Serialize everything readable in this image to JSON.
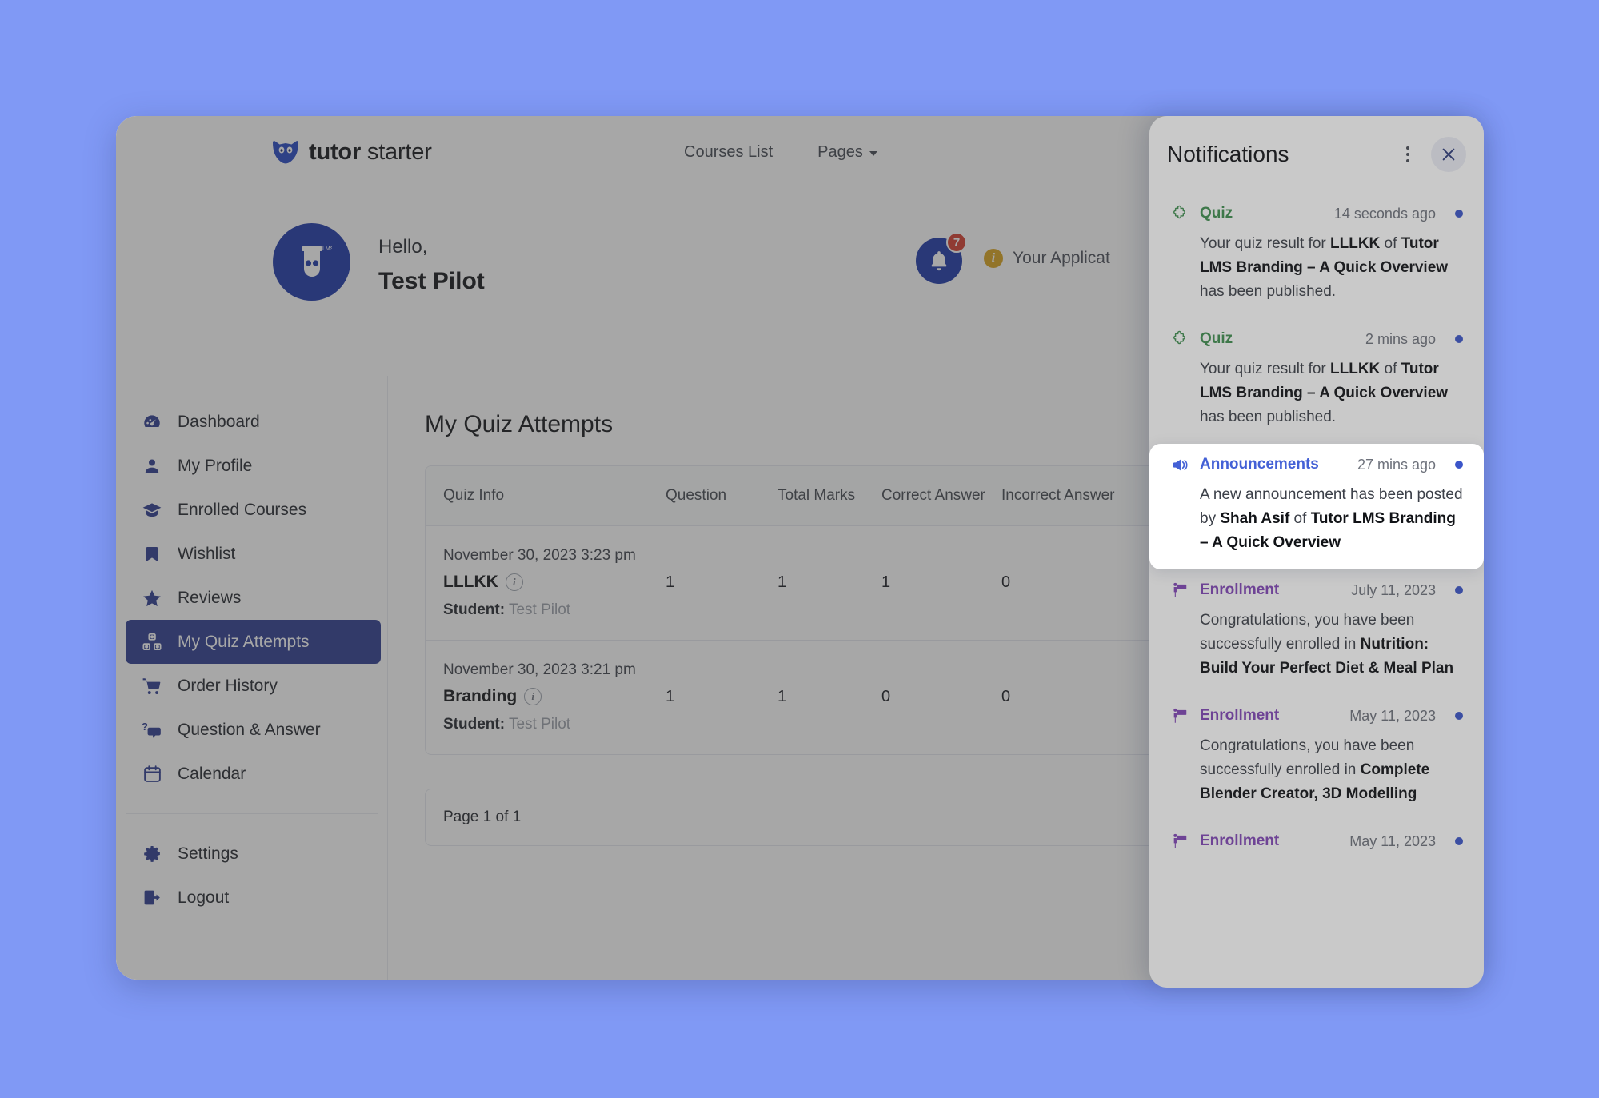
{
  "header": {
    "brand_bold": "tutor",
    "brand_light": " starter",
    "logo_icon": "owl-logo-icon",
    "nav": [
      {
        "label": "Courses List",
        "icon": ""
      },
      {
        "label": "Pages",
        "icon": "chevron-down-icon"
      }
    ]
  },
  "dashboard": {
    "avatar_icon": "tutor-lms-avatar-icon",
    "hello_label": "Hello,",
    "user_name": "Test Pilot",
    "bell_icon": "bell-icon",
    "bell_badge": "7",
    "info_icon": "info-circle-icon",
    "app_notice": "Your Applicat"
  },
  "sidebar": {
    "items": [
      {
        "label": "Dashboard",
        "icon": "dashboard-icon",
        "active": false
      },
      {
        "label": "My Profile",
        "icon": "user-icon",
        "active": false
      },
      {
        "label": "Enrolled Courses",
        "icon": "graduation-icon",
        "active": false
      },
      {
        "label": "Wishlist",
        "icon": "bookmark-icon",
        "active": false
      },
      {
        "label": "Reviews",
        "icon": "star-icon",
        "active": false
      },
      {
        "label": "My Quiz Attempts",
        "icon": "quiz-blocks-icon",
        "active": true
      },
      {
        "label": "Order History",
        "icon": "cart-icon",
        "active": false
      },
      {
        "label": "Question & Answer",
        "icon": "qa-icon",
        "active": false
      },
      {
        "label": "Calendar",
        "icon": "calendar-icon",
        "active": false
      }
    ],
    "footer_items": [
      {
        "label": "Settings",
        "icon": "gear-icon"
      },
      {
        "label": "Logout",
        "icon": "logout-icon"
      }
    ]
  },
  "main": {
    "page_title": "My Quiz Attempts",
    "table": {
      "columns": [
        "Quiz Info",
        "Question",
        "Total Marks",
        "Correct Answer",
        "Incorrect Answer"
      ],
      "rows": [
        {
          "date": "November 30, 2023 3:23 pm",
          "quiz_name": "LLLKK",
          "info_icon": "info-icon",
          "student_label": "Student:",
          "student_name": "Test Pilot",
          "question": "1",
          "total_marks": "1",
          "correct_answer": "1",
          "incorrect_answer": "0"
        },
        {
          "date": "November 30, 2023 3:21 pm",
          "quiz_name": "Branding",
          "info_icon": "info-icon",
          "student_label": "Student:",
          "student_name": "Test Pilot",
          "question": "1",
          "total_marks": "1",
          "correct_answer": "0",
          "incorrect_answer": "0"
        }
      ]
    },
    "pagination": "Page 1 of 1"
  },
  "notifications": {
    "title": "Notifications",
    "kebab_icon": "more-vertical-icon",
    "close_icon": "close-icon",
    "items": [
      {
        "type": "Quiz",
        "type_class": "quiz",
        "icon": "puzzle-icon",
        "time": "14 seconds ago",
        "unread": true,
        "highlight": false,
        "body_html": "Your quiz result for <b>LLLKK</b> of <b>Tutor LMS Branding – A Quick Overview</b> has been published."
      },
      {
        "type": "Quiz",
        "type_class": "quiz",
        "icon": "puzzle-icon",
        "time": "2 mins ago",
        "unread": true,
        "highlight": false,
        "body_html": "Your quiz result for <b>LLLKK</b> of <b>Tutor LMS Branding – A Quick Overview</b> has been published."
      },
      {
        "type": "Announcements",
        "type_class": "announcements",
        "icon": "megaphone-icon",
        "time": "27 mins ago",
        "unread": true,
        "highlight": true,
        "body_html": "A new announcement has been posted by <b>Shah Asif</b> of <b>Tutor LMS Branding – A Quick Overview</b>"
      },
      {
        "type": "Enrollment",
        "type_class": "enrollment",
        "icon": "enrollment-icon",
        "time": "July 11, 2023",
        "unread": true,
        "highlight": false,
        "body_html": "Congratulations, you have been successfully enrolled in <b>Nutrition: Build Your Perfect Diet &amp; Meal Plan</b>"
      },
      {
        "type": "Enrollment",
        "type_class": "enrollment",
        "icon": "enrollment-icon",
        "time": "May 11, 2023",
        "unread": true,
        "highlight": false,
        "body_html": "Congratulations, you have been successfully enrolled in <b>Complete Blender Creator, 3D Modelling</b>"
      },
      {
        "type": "Enrollment",
        "type_class": "enrollment",
        "icon": "enrollment-icon",
        "time": "May 11, 2023",
        "unread": true,
        "highlight": false,
        "body_html": ""
      }
    ]
  },
  "colors": {
    "page_background": "#8099F5",
    "brand_blue": "#1B35A8",
    "sidebar_active": "#2B3A8F",
    "badge_red": "#D63B2C",
    "quiz_green": "#3F8F4F",
    "announcement_blue": "#4461D6",
    "enrollment_purple": "#8246B8",
    "unread_dot": "#3B55C9",
    "info_amber": "#D9A21B"
  }
}
